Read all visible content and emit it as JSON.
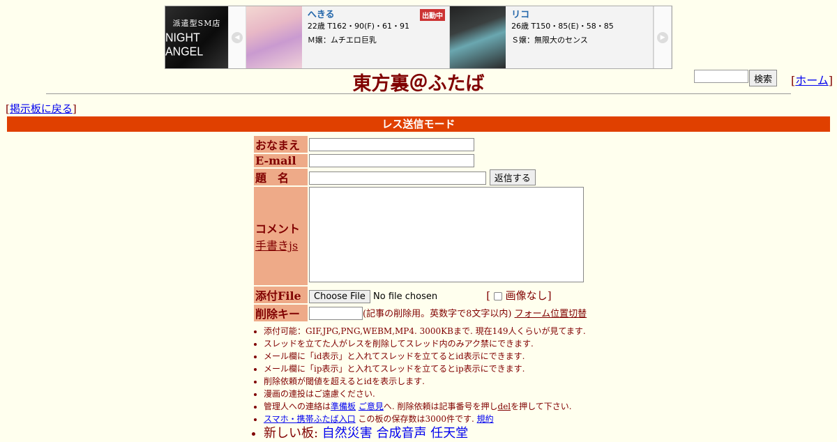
{
  "ad": {
    "logo_sub": "派遣型SM店",
    "logo_main": "NIGHT ANGEL",
    "cards": [
      {
        "name": "へきる",
        "stats": "22歳 T162・90(F)・61・91",
        "desc": "Ｍ嬢：ムチエロ巨乳",
        "badge": "出勤中"
      },
      {
        "name": "リコ",
        "stats": "26歳 T150・85(E)・58・85",
        "desc": "Ｓ嬢：無限大のセンス"
      }
    ]
  },
  "header": {
    "title": "東方裏＠ふたば",
    "search_button": "検索",
    "home_link": "ホーム",
    "back_link": "掲示板に戻る"
  },
  "mode_banner": "レス送信モード",
  "form": {
    "name_label": "おなまえ",
    "email_label": "E-mail",
    "subject_label": "題　名",
    "submit_button": "返信する",
    "comment_label": "コメント",
    "handwrite_link": "手書きjs",
    "file_label": "添付File",
    "choose_file_button": "Choose File",
    "no_file_text": "No file chosen",
    "no_image_label": "画像なし",
    "delkey_label": "削除キー",
    "delkey_note": "(記事の削除用。英数字で8文字以内)",
    "form_position_link": "フォーム位置切替"
  },
  "notes": {
    "n1": "添付可能：GIF,JPG,PNG,WEBM,MP4. 3000KBまで. 現在149人くらいが見てます.",
    "n2": "スレッドを立てた人がレスを削除してスレッド内のみアク禁にできます.",
    "n3": "メール欄に「id表示」と入れてスレッドを立てるとid表示にできます.",
    "n4": "メール欄に「ip表示」と入れてスレッドを立てるとip表示にできます.",
    "n5": "削除依頼が閾値を超えるとidを表示します.",
    "n6": "漫画の連投はご遠慮ください.",
    "n7_pre": "管理人への連絡は",
    "n7_link1": "準備板",
    "n7_link2": "ご意見",
    "n7_mid": "へ. 削除依頼は記事番号を押し",
    "n7_link3": "del",
    "n7_post": "を押して下さい.",
    "n8_link": "スマホ・携帯ふたば入口",
    "n8_mid": " この板の保存数は3000件です. ",
    "n8_link2": "規約",
    "n9_pre": "新しい板: ",
    "n9_link1": "自然災害",
    "n9_link2": "合成音声",
    "n9_link3": "任天堂"
  }
}
